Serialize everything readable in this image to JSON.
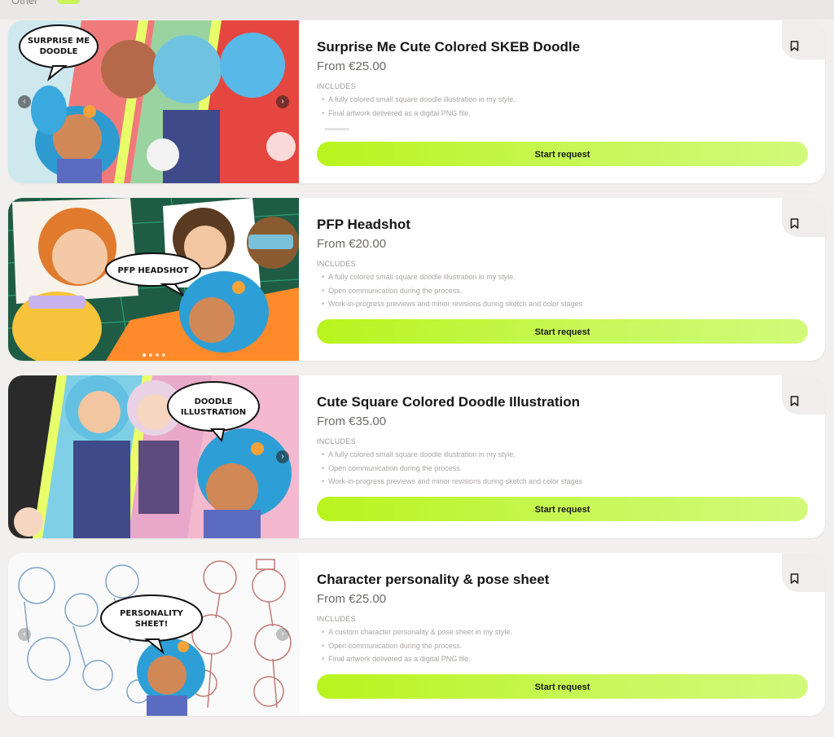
{
  "header": {
    "section_label": "Other"
  },
  "cards": [
    {
      "title": "Surprise Me Cute Colored SKEB Doodle",
      "price": "From €25.00",
      "includes_heading": "INCLUDES",
      "includes": [
        "A fully colored small square doodle illustration in my style.",
        "Final artwork delivered as a digital PNG file."
      ],
      "button": "Start request",
      "image_caption_lines": [
        "SURPRISE ME",
        "DOODLE"
      ]
    },
    {
      "title": "PFP Headshot",
      "price": "From €20.00",
      "includes_heading": "INCLUDES",
      "includes": [
        "A fully colored small square doodle illustration in my style.",
        "Open communication during the process.",
        "Work-in-progress previews and minor revisions during sketch and color stages"
      ],
      "button": "Start request",
      "image_caption_lines": [
        "PFP HEADSHOT"
      ]
    },
    {
      "title": "Cute Square Colored Doodle Illustration",
      "price": "From €35.00",
      "includes_heading": "INCLUDES",
      "includes": [
        "A fully colored small square doodle illustration in my style.",
        "Open communication during the process.",
        "Work-in-progress previews and minor revisions during sketch and color stages"
      ],
      "button": "Start request",
      "image_caption_lines": [
        "DOODLE",
        "ILLUSTRATION"
      ]
    },
    {
      "title": "Character personality & pose sheet",
      "price": "From €25.00",
      "includes_heading": "INCLUDES",
      "includes": [
        "A custom character personality & pose sheet in my style.",
        "Open communication during the process.",
        "Final artwork delivered as a digital PNG file."
      ],
      "button": "Start request",
      "image_caption_lines": [
        "PERSONALITY",
        "SHEET!"
      ]
    }
  ],
  "icons": {
    "bookmark": "bookmark-icon",
    "prev": "chevron-left-icon",
    "next": "chevron-right-icon"
  },
  "colors": {
    "accent": "#c2f73a",
    "card_bg": "#ffffff",
    "page_bg": "#f1f0ef"
  }
}
